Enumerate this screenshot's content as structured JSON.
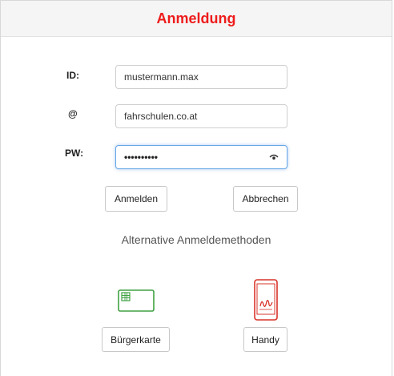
{
  "header": {
    "title": "Anmeldung"
  },
  "form": {
    "id": {
      "label": "ID:",
      "value": "mustermann.max"
    },
    "domain": {
      "label": "@",
      "value": "fahrschulen.co.at"
    },
    "password": {
      "label": "PW:",
      "masked_value": "••••••••••"
    }
  },
  "actions": {
    "login_label": "Anmelden",
    "cancel_label": "Abbrechen"
  },
  "alternatives": {
    "heading": "Alternative Anmeldemethoden",
    "card_label": "Bürgerkarte",
    "phone_label": "Handy"
  },
  "icons": {
    "card": "smartcard-icon",
    "phone": "mobile-signature-icon",
    "eye": "eye-icon"
  },
  "colors": {
    "title": "#ee1c1c",
    "card_icon": "#3fa142",
    "phone_icon": "#d9342b",
    "focus": "#66a7e8"
  }
}
